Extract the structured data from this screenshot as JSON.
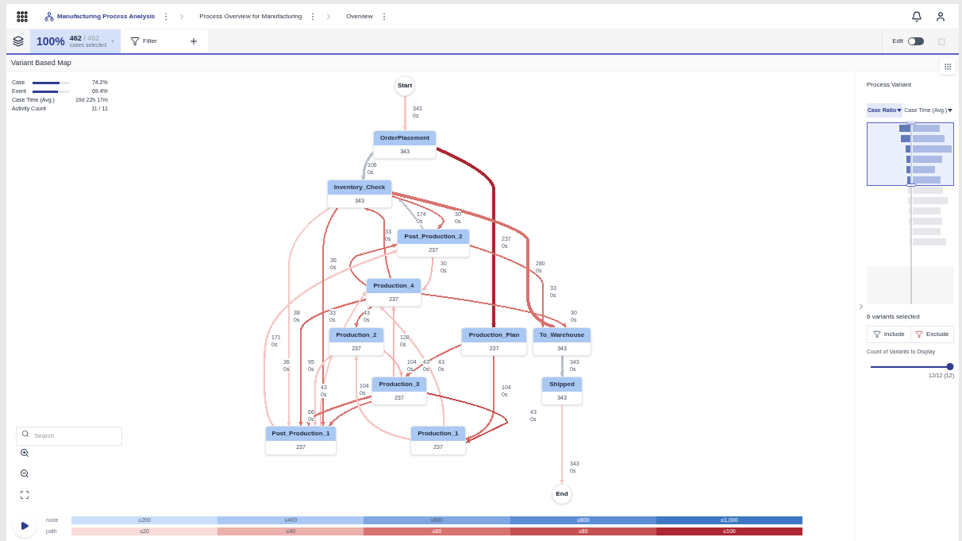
{
  "breadcrumbs": [
    {
      "label": "Manufacturing Process Analysis",
      "kind": "app"
    },
    {
      "label": "Process Overview for Manufacturing",
      "kind": "page"
    },
    {
      "label": "Overview",
      "kind": "page"
    }
  ],
  "selection": {
    "percent": "100%",
    "selected": "462",
    "total": "/ 462",
    "caption": "cases selected"
  },
  "filter": {
    "label": "Filter"
  },
  "edit": {
    "label": "Edit",
    "on": false
  },
  "panel_title": "Variant Based Map",
  "stats": [
    {
      "label": "Case",
      "kind": "bar",
      "level": 0.742,
      "value": "74.2%"
    },
    {
      "label": "Event",
      "kind": "bar",
      "level": 0.694,
      "value": "69.4%"
    },
    {
      "label": "Case Time (Avg.)",
      "kind": "text",
      "value": "19d 22h 17m"
    },
    {
      "label": "Activity Count",
      "kind": "text",
      "value": "11 / 11"
    }
  ],
  "nodes": [
    {
      "name": "Start",
      "kind": "terminal"
    },
    {
      "name": "OrderPlacement",
      "count": "343",
      "kind": "activity"
    },
    {
      "name": "Inventory_Check",
      "count": "343",
      "kind": "activity"
    },
    {
      "name": "Post_Production_2",
      "count": "237",
      "kind": "activity"
    },
    {
      "name": "Production_4",
      "count": "237",
      "kind": "activity"
    },
    {
      "name": "Production_2",
      "count": "237",
      "kind": "activity"
    },
    {
      "name": "Production_Plan",
      "count": "237",
      "kind": "activity"
    },
    {
      "name": "To_Warehouse",
      "count": "343",
      "kind": "activity"
    },
    {
      "name": "Production_3",
      "count": "237",
      "kind": "activity"
    },
    {
      "name": "Shipped",
      "count": "343",
      "kind": "activity"
    },
    {
      "name": "Post_Production_1",
      "count": "237",
      "kind": "activity"
    },
    {
      "name": "Production_1",
      "count": "237",
      "kind": "activity"
    },
    {
      "name": "End",
      "kind": "terminal"
    }
  ],
  "edges": [
    {
      "count": "343",
      "time": "0s",
      "color": "#f6c9c6"
    },
    {
      "count": "106",
      "time": "0s",
      "color": "#b9bec8"
    },
    {
      "count": "174",
      "time": "0s",
      "color": "#b9bec8"
    },
    {
      "count": "30",
      "time": "0s",
      "color": "#d9736f"
    },
    {
      "count": "33",
      "time": "0s",
      "color": "#d9736f"
    },
    {
      "count": "237",
      "time": "0s",
      "color": "#ad2633"
    },
    {
      "count": "36",
      "time": "0s",
      "color": "#d9736f"
    },
    {
      "count": "30",
      "time": "0s",
      "color": "#f3b8b5"
    },
    {
      "count": "280",
      "time": "0s",
      "color": "#d9736f"
    },
    {
      "count": "33",
      "time": "0s",
      "color": "#d9736f"
    },
    {
      "count": "38",
      "time": "0s",
      "color": "#d9736f"
    },
    {
      "count": "33",
      "time": "0s",
      "color": "#f6c9c6"
    },
    {
      "count": "43",
      "time": "0s",
      "color": "#d9736f"
    },
    {
      "count": "30",
      "time": "0s",
      "color": "#d9736f"
    },
    {
      "count": "171",
      "time": "0s",
      "color": "#f6c9c6"
    },
    {
      "count": "128",
      "time": "0s",
      "color": "#f3b8b5"
    },
    {
      "count": "36",
      "time": "0s",
      "color": "#f6c9c6"
    },
    {
      "count": "95",
      "time": "0s",
      "color": "#d9736f"
    },
    {
      "count": "104",
      "time": "0s",
      "color": "#d9736f"
    },
    {
      "count": "43",
      "time": "0s",
      "color": "#f3b8b5"
    },
    {
      "count": "43",
      "time": "0s",
      "color": "#f6c9c6"
    },
    {
      "count": "343",
      "time": "0s",
      "color": "#b9bec8"
    },
    {
      "count": "43",
      "time": "0s",
      "color": "#f6c9c6"
    },
    {
      "count": "104",
      "time": "0s",
      "color": "#d9736f"
    },
    {
      "count": "104",
      "time": "0s",
      "color": "#d9736f"
    },
    {
      "count": "66",
      "time": "0s",
      "color": "#d9736f"
    },
    {
      "count": "43",
      "time": "0s",
      "color": "#c55050"
    },
    {
      "count": "343",
      "time": "0s",
      "color": "#f6c9c6"
    },
    {
      "color": "#f6c9c6"
    }
  ],
  "search": {
    "placeholder": "Search"
  },
  "legend": [
    {
      "label": "node",
      "bins": [
        {
          "label": "≤200",
          "color": "#c9dffb"
        },
        {
          "label": "≤400",
          "color": "#a9c8f3"
        },
        {
          "label": "≤600",
          "color": "#7fa8e2"
        },
        {
          "label": "≤800",
          "color": "#5b8cd6"
        },
        {
          "label": "≤1,000",
          "color": "#3e78c4"
        }
      ]
    },
    {
      "label": "path",
      "bins": [
        {
          "label": "≤20",
          "color": "#f8dcdb"
        },
        {
          "label": "≤40",
          "color": "#ecb0ad"
        },
        {
          "label": "≤60",
          "color": "#d9736f"
        },
        {
          "label": "≤80",
          "color": "#c55050"
        },
        {
          "label": "≤100",
          "color": "#ad2633"
        }
      ]
    }
  ],
  "variant_panel": {
    "title": "Process Variant",
    "tabs": [
      {
        "label": "Case Ratio",
        "selected": true
      },
      {
        "label": "Case Time (Avg.)",
        "selected": false
      }
    ],
    "selected_text": "6 variants selected",
    "actions": [
      {
        "label": "Include",
        "kind": "include"
      },
      {
        "label": "Exclude",
        "kind": "exclude"
      }
    ],
    "count_label": "Count of Variants to Display",
    "slider": {
      "level": 1,
      "reading": "12/12 (12)"
    }
  }
}
